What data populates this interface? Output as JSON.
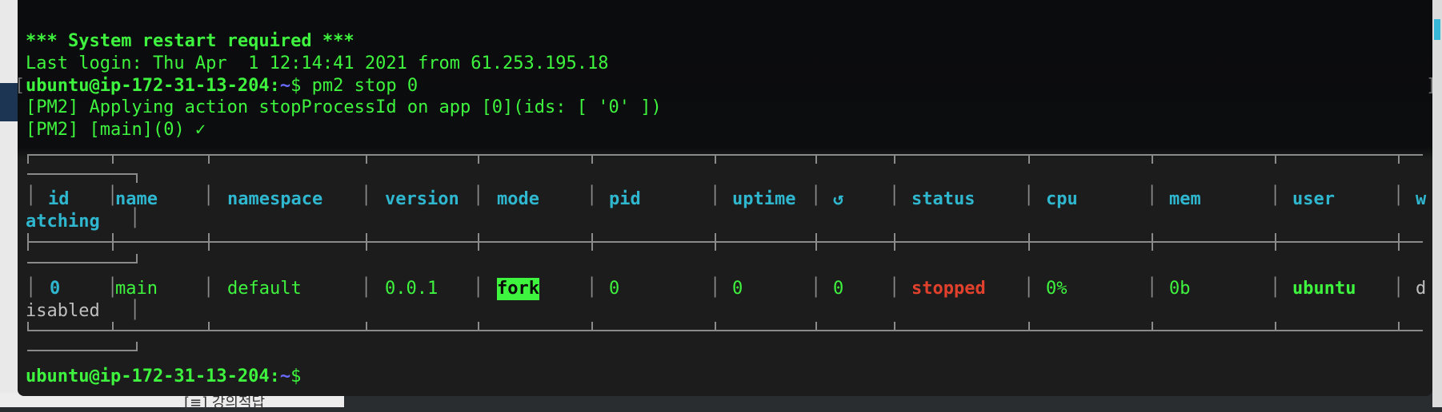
{
  "desktop": {
    "bottom_label": "[≡] 강의적답"
  },
  "terminal": {
    "restart_notice": "*** System restart required ***",
    "last_login": "Last login: Thu Apr  1 12:14:41 2021 from 61.253.195.18",
    "prompt_user_host": "ubuntu@ip-172-31-13-204",
    "prompt_sep": ":",
    "prompt_path": "~",
    "prompt_dollar": "$",
    "command": " pm2 stop 0",
    "pm2_line1": "[PM2] Applying action stopProcessId on app [0](ids: [ '0' ])",
    "pm2_line2_prefix": "[PM2] ",
    "pm2_line2_rest": "[main](0) ✓"
  },
  "table": {
    "headers": {
      "id": "id",
      "name": "name",
      "namespace": "namespace",
      "version": "version",
      "mode": "mode",
      "pid": "pid",
      "uptime": "uptime",
      "restarts": "↺",
      "status": "status",
      "cpu": "cpu",
      "mem": "mem",
      "user": "user",
      "watching_first": "w",
      "watching_rest": "atching"
    },
    "row": {
      "id": "0",
      "name": "main",
      "namespace": "default",
      "version": "0.0.1",
      "mode": "fork",
      "pid": "0",
      "uptime": "0",
      "restarts": "0",
      "status": "stopped",
      "cpu": "0%",
      "mem": "0b",
      "user": "ubuntu",
      "watching_first": "d",
      "watching_rest": "isabled"
    }
  },
  "colors": {
    "terminal_green": "#3ef43e",
    "header_cyan": "#2fb7cf",
    "status_stopped": "#e0402c",
    "path_blue": "#6a6cff"
  }
}
